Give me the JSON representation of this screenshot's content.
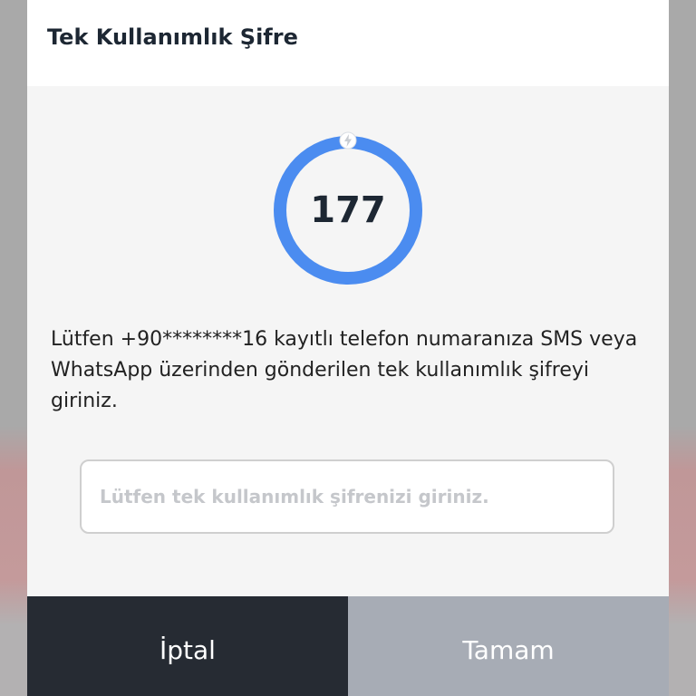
{
  "dialog": {
    "title": "Tek Kullanımlık Şifre",
    "countdown": "177",
    "countdown_progress": 1.0,
    "message": "Lütfen +90********16 kayıtlı telefon numaranıza SMS veya WhatsApp üzerinden gönderilen tek kullanımlık şifreyi giriniz.",
    "input": {
      "placeholder": "Lütfen tek kullanımlık şifrenizi giriniz.",
      "value": ""
    },
    "buttons": {
      "cancel_label": "İptal",
      "ok_label": "Tamam"
    },
    "colors": {
      "ring": "#4b8cf0",
      "cancel_bg": "#262b33",
      "ok_bg": "#a7acb5"
    },
    "icons": {
      "timer_knob": "bolt-icon"
    }
  }
}
